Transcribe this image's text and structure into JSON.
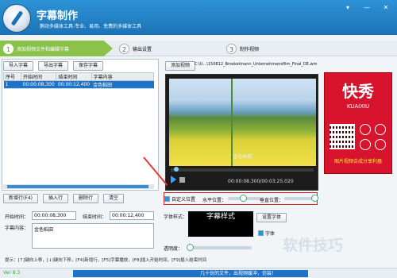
{
  "app": {
    "title": "字幕制作",
    "subtitle": "鹅动多媒体工具-专业、易用、免费的多媒体工具",
    "window_buttons": [
      "▾",
      "—",
      "✕"
    ]
  },
  "steps": [
    {
      "num": "1",
      "label": "添加视频文件和编辑字幕"
    },
    {
      "num": "2",
      "label": "输出设置"
    },
    {
      "num": "3",
      "label": "制作视频"
    }
  ],
  "left_toolbar": {
    "import": "导入字幕",
    "export": "导出字幕",
    "save": "保存字幕"
  },
  "table": {
    "headers": [
      "序号",
      "开始时间",
      "结束时间",
      "字幕内容"
    ],
    "rows": [
      [
        "1",
        "00:00:08,300",
        "00:00:12,400",
        "金色稻田"
      ]
    ]
  },
  "row_actions": {
    "edit": "新增行(F4)",
    "insert": "插入行",
    "delete": "删除行",
    "clear": "清空"
  },
  "file": {
    "add_label": "添加视频",
    "path": "C:\\U...\\150812_Broekelmann_Unternehmensfilm_Final_DE.wmv"
  },
  "player": {
    "caption": "金色稻田",
    "timecode": "00:00:08.300/00:03:25.020"
  },
  "brand": {
    "big": "快秀",
    "en": "KUAIXIU",
    "slogan": "图片视频合成分享利器"
  },
  "position": {
    "custom_pos": "自定义位置",
    "h_label": "水平位置：",
    "v_label": "垂直位置：",
    "h_value": 0.35,
    "v_value": 0.85
  },
  "timing": {
    "start_label": "开始时间：",
    "start_value": "00:00:08,300",
    "end_label": "结束时间：",
    "end_value": "00:00:12,400"
  },
  "content": {
    "label": "字幕内容：",
    "value": "金色稻田"
  },
  "font": {
    "label": "字体样式：",
    "preview": "字幕样式",
    "set_button": "设置字体",
    "style_label": "字体"
  },
  "transparency": {
    "label": "透明度："
  },
  "hint": "提示：[↑]键向上移，[↓]键向下移，[F4]新增行，[F5]字幕播放，[F8]插入开始时间，[F9]插入结束时间",
  "status": {
    "version": "Ver 8.3",
    "progress_text": "几十份的文件，出视频缓冲，仿装！"
  },
  "watermark": "软件技巧",
  "colors": {
    "titlebar": "#2d93d6",
    "accent_step": "#8bc34a",
    "brand_red": "#d7132d",
    "select_blue": "#1e73c7"
  }
}
